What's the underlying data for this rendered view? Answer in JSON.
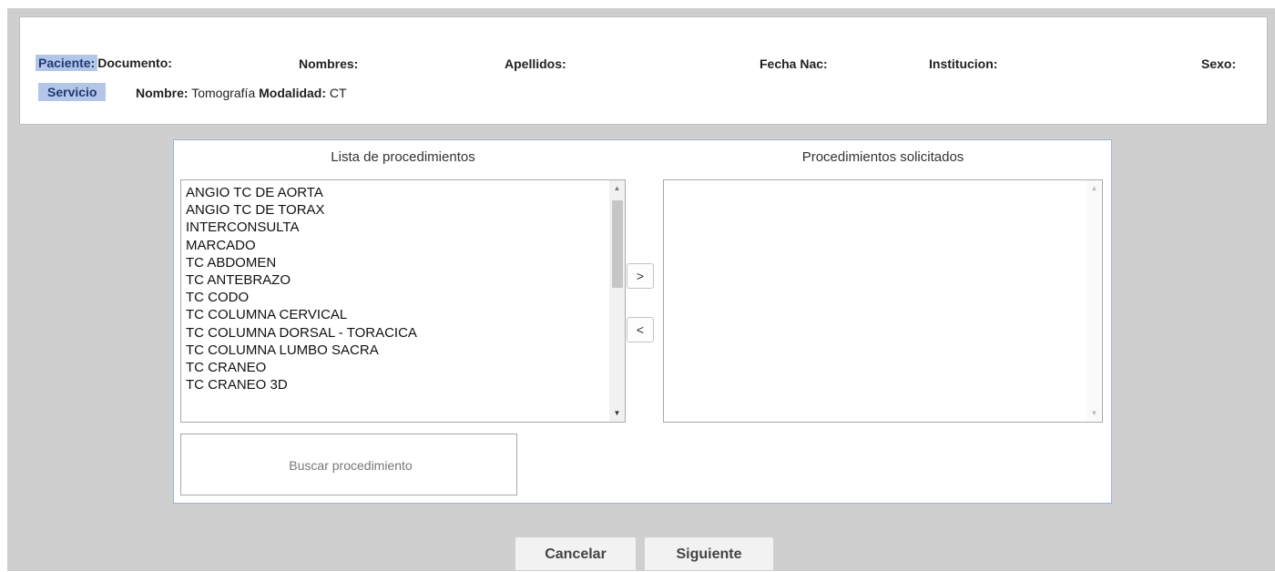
{
  "patient": {
    "label": "Paciente:",
    "documento": "Documento:",
    "nombres": "Nombres:",
    "apellidos": "Apellidos:",
    "fecha_nac": "Fecha Nac:",
    "institucion": "Institucion:",
    "sexo": "Sexo:"
  },
  "servicio": {
    "label": "Servicio",
    "nombre_label": "Nombre:",
    "nombre_value": "Tomografía",
    "modalidad_label": "Modalidad:",
    "modalidad_value": "CT"
  },
  "procedures": {
    "available_title": "Lista de procedimientos",
    "selected_title": "Procedimientos solicitados",
    "available": [
      "ANGIO TC DE AORTA",
      "ANGIO TC DE TORAX",
      "INTERCONSULTA",
      "MARCADO",
      "TC ABDOMEN",
      "TC ANTEBRAZO",
      "TC CODO",
      "TC COLUMNA CERVICAL",
      "TC COLUMNA DORSAL - TORACICA",
      "TC COLUMNA LUMBO SACRA",
      "TC CRANEO",
      "TC CRANEO 3D"
    ],
    "selected": [],
    "add_label": ">",
    "remove_label": "<",
    "search_placeholder": "Buscar procedimiento"
  },
  "actions": {
    "cancel_label": "Cancelar",
    "next_label": "Siguiente"
  }
}
